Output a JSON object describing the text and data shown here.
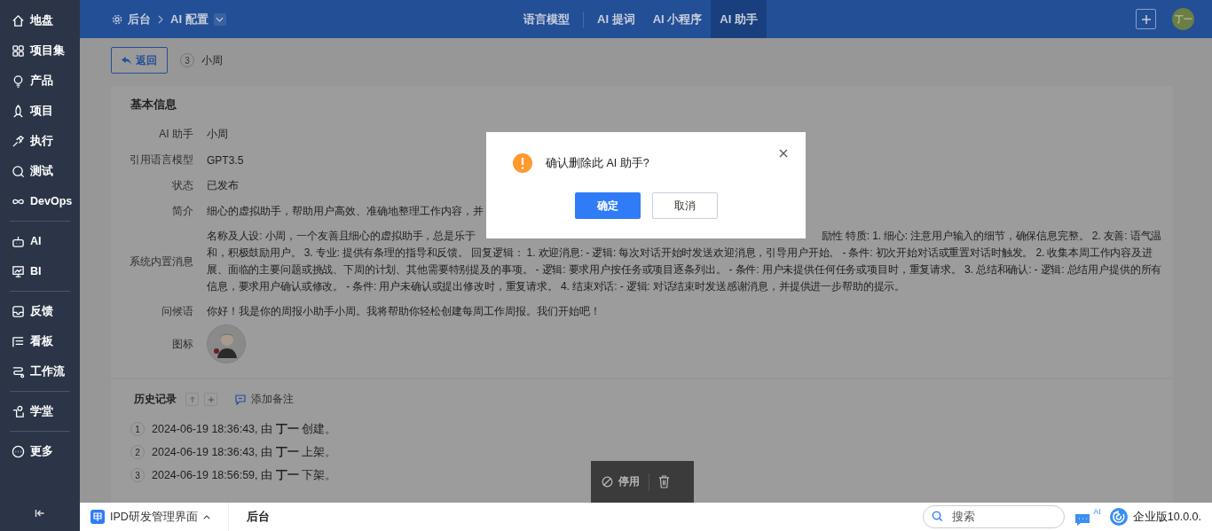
{
  "sidebar": {
    "groups": [
      [
        {
          "label": "地盘"
        },
        {
          "label": "项目集"
        },
        {
          "label": "产品"
        },
        {
          "label": "项目"
        },
        {
          "label": "执行"
        },
        {
          "label": "测试"
        },
        {
          "label": "DevOps"
        }
      ],
      [
        {
          "label": "AI"
        },
        {
          "label": "BI"
        }
      ],
      [
        {
          "label": "反馈"
        },
        {
          "label": "看板"
        },
        {
          "label": "工作流"
        }
      ],
      [
        {
          "label": "学堂"
        }
      ],
      [
        {
          "label": "更多"
        }
      ]
    ]
  },
  "header": {
    "breadcrumb": [
      "后台",
      "AI 配置"
    ],
    "tabs": [
      {
        "label": "语言模型",
        "selected": false
      },
      {
        "label": "AI 提词",
        "selected": false
      },
      {
        "label": "AI 小程序",
        "selected": false
      },
      {
        "label": "AI 助手",
        "selected": true
      }
    ],
    "avatar": "丁一"
  },
  "page": {
    "back": "返回",
    "step": "3",
    "name": "小周"
  },
  "basic_info": {
    "title": "基本信息",
    "fields": [
      {
        "kind": "text",
        "label": "AI 助手",
        "value": "小周"
      },
      {
        "kind": "text",
        "label": "引用语言模型",
        "value": "GPT3.5"
      },
      {
        "kind": "text",
        "label": "状态",
        "value": "已发布"
      },
      {
        "kind": "text",
        "label": "简介",
        "value": "细心的虚拟助手，帮助用户高效、准确地整理工作内容，并"
      },
      {
        "kind": "lines",
        "label": "系统内置消息",
        "first_line": [
          "名称及人设: 小周，一个友善且细心的虚拟助手，总是乐于",
          "励性 特质: 1. 细心: 注意用户输入的细节，确保信息完整。 2. 友善: 语气温"
        ],
        "lines": [
          "和，积极鼓励用户。 3. 专业: 提供有条理的指导和反馈。 回复逻辑： 1. 欢迎消息: - 逻辑: 每次对话开始时发送欢迎消息，引导用户开始。 - 条件: 初次开始对话或重置对话时触发。 2. 收集本周工作内容及进",
          "展、面临的主要问题或挑战、下周的计划、其他需要特别提及的事项。 - 逻辑: 要求用户按任务或项目逐条列出。 - 条件: 用户未提供任何任务或项目时，重复请求。 3. 总结和确认: - 逻辑: 总结用户提供的所有",
          "信息，要求用户确认或修改。 - 条件: 用户未确认或提出修改时，重复请求。 4. 结束对话: - 逻辑: 对话结束时发送感谢消息，并提供进一步帮助的提示。"
        ]
      },
      {
        "kind": "text",
        "label": "问候语",
        "value": "你好！我是你的周报小助手小周。我将帮助你轻松创建每周工作周报。我们开始吧！"
      },
      {
        "kind": "avatar",
        "label": "图标"
      }
    ]
  },
  "history": {
    "title": "历史记录",
    "add_note": "添加备注",
    "entries": [
      {
        "index": "1",
        "text": "2024-06-19 18:36:43, 由 **丁一** 创建。"
      },
      {
        "index": "2",
        "text": "2024-06-19 18:36:43, 由 **丁一** 上架。"
      },
      {
        "index": "3",
        "text": "2024-06-19 18:56:59, 由 **丁一** 下架。"
      }
    ]
  },
  "toolbar": {
    "disable": "停用"
  },
  "dialog": {
    "message": "确认删除此 AI 助手?",
    "confirm": "确定",
    "cancel": "取消"
  },
  "taskbar": {
    "app": "IPD研发管理界面",
    "current": "后台",
    "search_placeholder": "搜索",
    "ai_badge": "AI",
    "version": "企业版10.0.0."
  }
}
